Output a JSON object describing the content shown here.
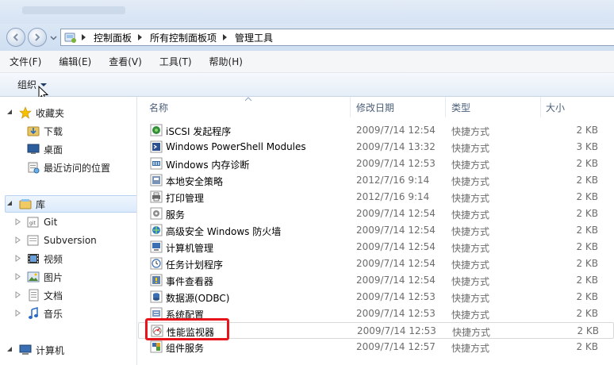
{
  "address": {
    "crumbs": [
      "控制面板",
      "所有控制面板项",
      "管理工具"
    ]
  },
  "menu": {
    "items": [
      "文件(F)",
      "编辑(E)",
      "查看(V)",
      "工具(T)",
      "帮助(H)"
    ]
  },
  "toolbar": {
    "organize_label": "组织"
  },
  "navpane": {
    "favorites": {
      "label": "收藏夹",
      "items": [
        "下载",
        "桌面",
        "最近访问的位置"
      ]
    },
    "library": {
      "label": "库",
      "items": [
        "Git",
        "Subversion",
        "视频",
        "图片",
        "文档",
        "音乐"
      ]
    },
    "computer": {
      "label": "计算机"
    }
  },
  "columns": {
    "name": "名称",
    "date": "修改日期",
    "type": "类型",
    "size": "大小"
  },
  "files": [
    {
      "name": "iSCSI 发起程序",
      "date": "2009/7/14 12:54",
      "type": "快捷方式",
      "size": "2 KB"
    },
    {
      "name": "Windows PowerShell Modules",
      "date": "2009/7/14 13:32",
      "type": "快捷方式",
      "size": "3 KB"
    },
    {
      "name": "Windows 内存诊断",
      "date": "2009/7/14 12:53",
      "type": "快捷方式",
      "size": "2 KB"
    },
    {
      "name": "本地安全策略",
      "date": "2012/7/16 9:14",
      "type": "快捷方式",
      "size": "2 KB"
    },
    {
      "name": "打印管理",
      "date": "2012/7/16 9:14",
      "type": "快捷方式",
      "size": "2 KB"
    },
    {
      "name": "服务",
      "date": "2009/7/14 12:54",
      "type": "快捷方式",
      "size": "2 KB"
    },
    {
      "name": "高级安全 Windows 防火墙",
      "date": "2009/7/14 12:54",
      "type": "快捷方式",
      "size": "2 KB"
    },
    {
      "name": "计算机管理",
      "date": "2009/7/14 12:54",
      "type": "快捷方式",
      "size": "2 KB"
    },
    {
      "name": "任务计划程序",
      "date": "2009/7/14 12:54",
      "type": "快捷方式",
      "size": "2 KB"
    },
    {
      "name": "事件查看器",
      "date": "2009/7/14 12:54",
      "type": "快捷方式",
      "size": "2 KB"
    },
    {
      "name": "数据源(ODBC)",
      "date": "2009/7/14 12:53",
      "type": "快捷方式",
      "size": "2 KB"
    },
    {
      "name": "系统配置",
      "date": "2009/7/14 12:53",
      "type": "快捷方式",
      "size": "2 KB"
    },
    {
      "name": "性能监视器",
      "date": "2009/7/14 12:53",
      "type": "快捷方式",
      "size": "2 KB"
    },
    {
      "name": "组件服务",
      "date": "2009/7/14 12:57",
      "type": "快捷方式",
      "size": "2 KB"
    }
  ],
  "colors": {
    "highlight_box": "#e8141b",
    "accent": "#3c7fb1"
  }
}
